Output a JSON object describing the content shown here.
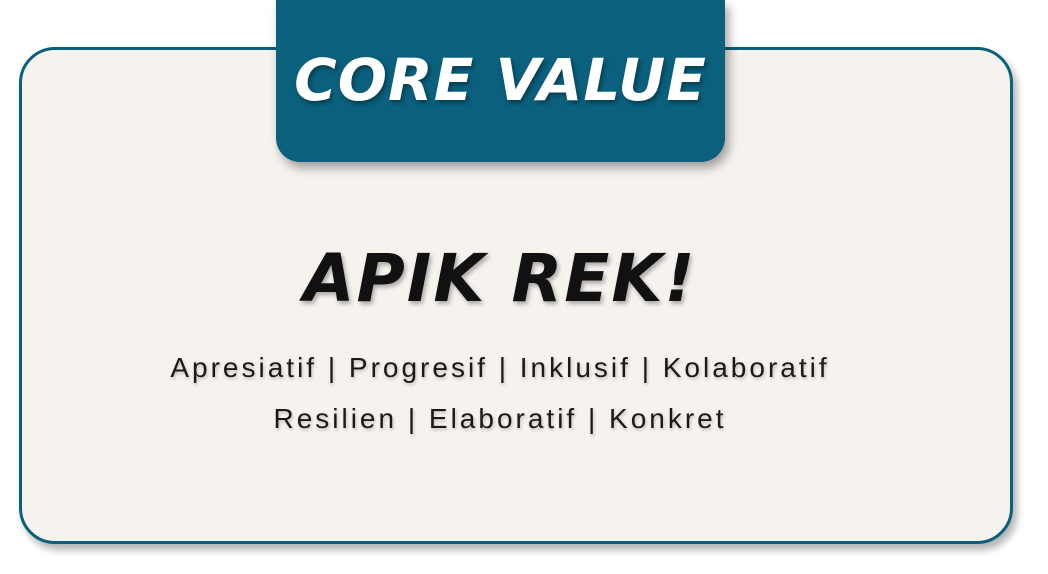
{
  "badge": {
    "title": "CORE VALUE"
  },
  "headline": "APIK REK!",
  "values": {
    "line1": "Apresiatif | Progresif | Inklusif | Kolaboratif",
    "line2": "Resilien | Elaboratif | Konkret"
  },
  "colors": {
    "accent": "#0a607d",
    "card_background": "#f6f2ee",
    "text": "#111111"
  }
}
